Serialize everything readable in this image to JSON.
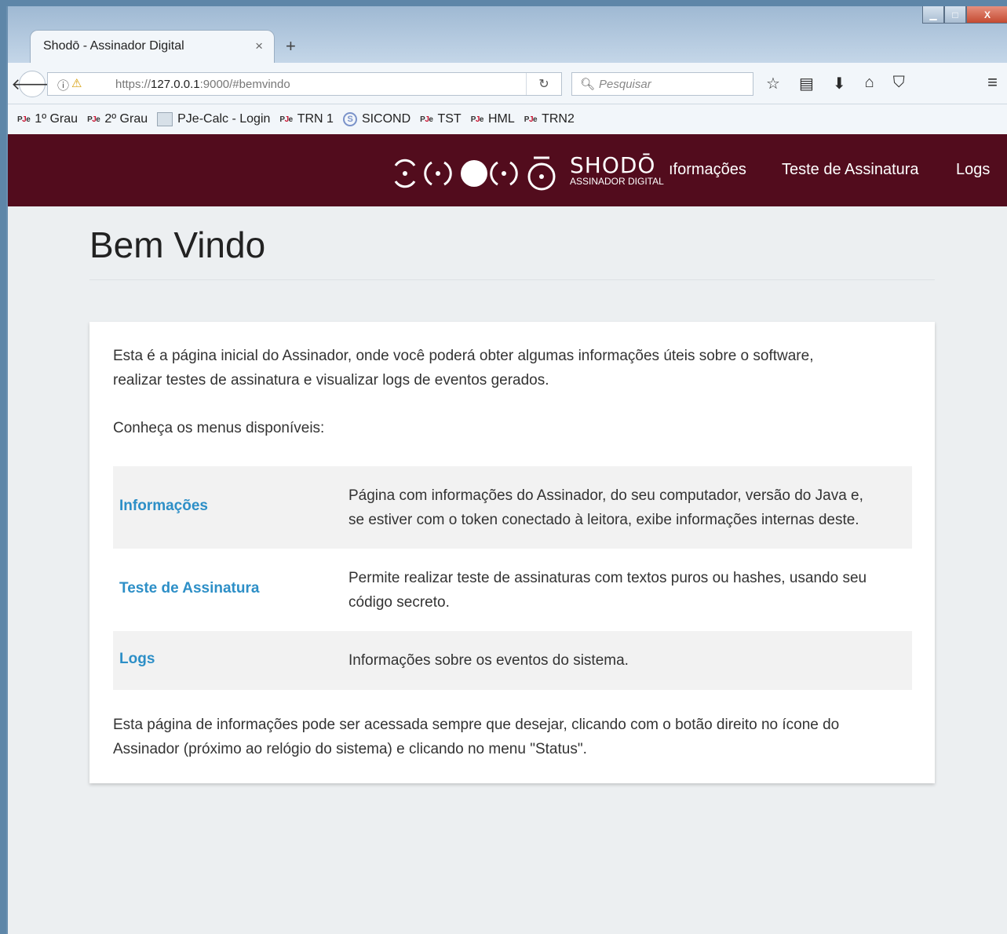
{
  "browser": {
    "tab_title": "Shodō - Assinador Digital",
    "tab_close": "×",
    "new_tab": "+",
    "url_prefix": "https://",
    "url_host": "127.0.0.1",
    "url_rest": ":9000/#bemvindo",
    "search_placeholder": "Pesquisar",
    "window_buttons": {
      "minimize": "▁",
      "maximize": "□",
      "close": "X"
    },
    "bookmarks": [
      {
        "icon": "pje",
        "label": "1º Grau"
      },
      {
        "icon": "pje",
        "label": "2º Grau"
      },
      {
        "icon": "calc",
        "label": "PJe-Calc - Login"
      },
      {
        "icon": "pje",
        "label": "TRN 1"
      },
      {
        "icon": "sicond",
        "label": "SICOND"
      },
      {
        "icon": "pje",
        "label": "TST"
      },
      {
        "icon": "pje",
        "label": "HML"
      },
      {
        "icon": "pje",
        "label": "TRN2"
      }
    ]
  },
  "app": {
    "logo_title": "SHODŌ",
    "logo_subtitle": "ASSINADOR DIGITAL",
    "nav": {
      "info": "ıformações",
      "test": "Teste de Assinatura",
      "logs": "Logs"
    },
    "colors": {
      "header": "#520c1d",
      "link": "#2d8fc7"
    }
  },
  "page": {
    "title": "Bem Vindo",
    "intro_line1": "Esta é a página inicial do Assinador, onde você poderá obter algumas informações úteis sobre o software,",
    "intro_line2": "realizar testes de assinatura e visualizar logs de eventos gerados.",
    "menus_label": "Conheça os menus disponíveis:",
    "menus": [
      {
        "name": "Informações",
        "desc_line1": "Página com informações do Assinador, do seu computador, versão do Java e,",
        "desc_line2": "se estiver com o token conectado à leitora, exibe informações internas deste."
      },
      {
        "name": "Teste de Assinatura",
        "desc_line1": "Permite realizar teste de assinaturas com textos puros ou hashes, usando seu",
        "desc_line2": "código secreto."
      },
      {
        "name": "Logs",
        "desc_line1": "Informações sobre os eventos do sistema.",
        "desc_line2": ""
      }
    ],
    "footer_line1": "Esta página de informações pode ser acessada sempre que desejar, clicando com o botão direito no ícone do",
    "footer_line2": "Assinador (próximo ao relógio do sistema) e clicando no menu \"Status\"."
  }
}
